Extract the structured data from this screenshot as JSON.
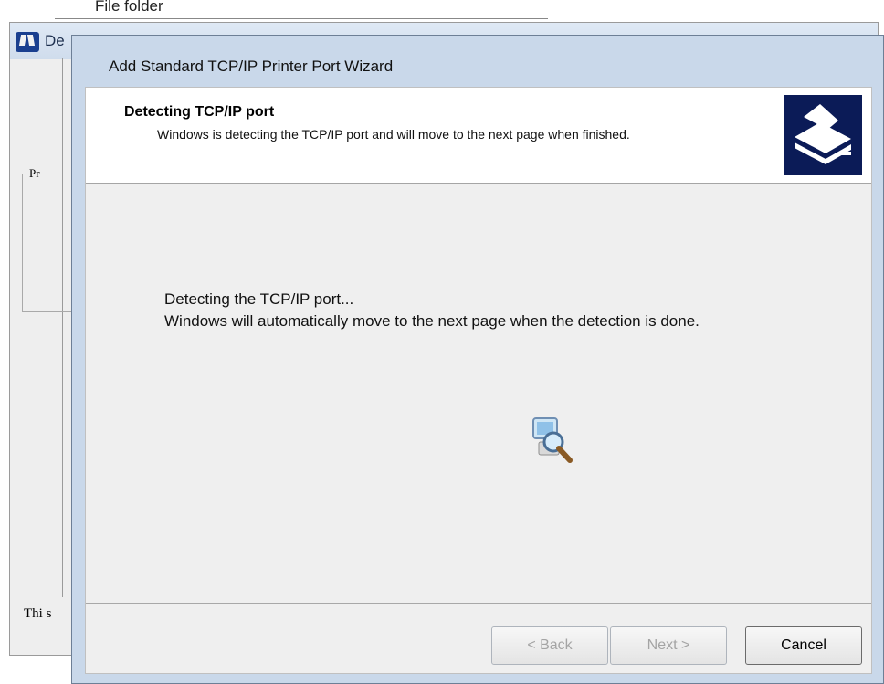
{
  "background_window": {
    "top_text": "File folder",
    "title": "De",
    "group_label": "Pr",
    "footer_text": "Thi s"
  },
  "wizard": {
    "title": "Add Standard TCP/IP Printer Port Wizard",
    "header": {
      "title": "Detecting TCP/IP port",
      "subtitle": "Windows is detecting the TCP/IP port and will move to the next page when finished."
    },
    "body": {
      "line1": "Detecting the TCP/IP port...",
      "line2": "Windows will automatically move to the next page when the detection is done."
    },
    "buttons": {
      "back": "< Back",
      "next": "Next >",
      "cancel": "Cancel"
    }
  },
  "icons": {
    "app_icon": "windows-app-icon",
    "header_icon": "printer-icon",
    "progress_icon": "search-computer-icon"
  },
  "colors": {
    "header_icon_bg": "#0b1b57",
    "title_bar": "#c9d8ea"
  }
}
